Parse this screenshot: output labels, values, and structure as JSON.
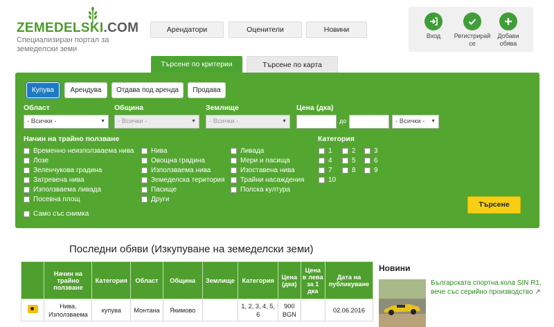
{
  "header": {
    "logo_text": "ZEMEDELSKI",
    "logo_com": ".COM",
    "tagline": "Специализиран портал за земеделски земи",
    "nav": [
      "Арендатори",
      "Оценители",
      "Новини"
    ],
    "user_menu": [
      {
        "label": "Вход",
        "icon": "login-icon"
      },
      {
        "label": "Регистрирай се",
        "icon": "checkmark-icon"
      },
      {
        "label": "Добави обява",
        "icon": "plus-icon"
      }
    ]
  },
  "tabs": [
    {
      "label": "Търсене по критерии",
      "active": true
    },
    {
      "label": "Търсене по карта",
      "active": false
    }
  ],
  "search": {
    "type_buttons": [
      {
        "label": "Купува",
        "active": true
      },
      {
        "label": "Арендува",
        "active": false
      },
      {
        "label": "Отдава под аренда",
        "active": false
      },
      {
        "label": "Продава",
        "active": false
      }
    ],
    "labels": {
      "region": "Област",
      "municipality": "Община",
      "land": "Землище",
      "price": "Цена (дка)",
      "usage": "Начин на трайно ползване",
      "category": "Категория",
      "to": "до"
    },
    "selects": {
      "region": "- Всички -",
      "municipality": "- Всички -",
      "land": "- Всички -",
      "currency": "- Всички -"
    },
    "usage_col1": [
      "Временно неизползваема нива",
      "Лозе",
      "Зеленчукова градина",
      "Затревена нива",
      "Използваема ливада",
      "Посевна площ"
    ],
    "usage_col2": [
      "Нива",
      "Овощна градина",
      "Използваема нива",
      "Земеделска територия",
      "Пасище",
      "Други"
    ],
    "usage_col3": [
      "Ливада",
      "Мери и пасища",
      "Изоставена нива",
      "Трайни насаждения",
      "Полска култура"
    ],
    "categories": [
      "1",
      "2",
      "3",
      "4",
      "5",
      "6",
      "7",
      "8",
      "9",
      "10"
    ],
    "photo_only": "Само със снимка",
    "submit": "Търсене"
  },
  "listing": {
    "title": "Последни обяви (Изкупуване на земеделски земи)",
    "headers": [
      "",
      "Начин на трайно ползване",
      "Категория",
      "Област",
      "Община",
      "Землище",
      "Категория",
      "Цена (дка)",
      "Цена в лева за 1 дка",
      "Дата на публикуване"
    ],
    "rows": [
      {
        "usage": "Нива, Използваема",
        "type": "купува",
        "region": "Монтана",
        "municipality": "Якимово",
        "land": "",
        "category": "1, 2, 3, 4, 5, 6",
        "price": "900 BGN",
        "price_per": "",
        "date": "02.06.2016"
      }
    ]
  },
  "news": {
    "heading": "Новини",
    "item": "Българската спортна кола SIN R1, вече със серийно производство"
  },
  "colors": {
    "brand_green": "#4ca431",
    "panel_green": "#53a630",
    "active_blue": "#1e7ac1",
    "search_yellow": "#f7ce14"
  }
}
